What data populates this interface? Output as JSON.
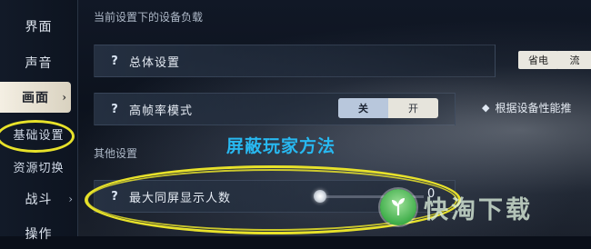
{
  "sidebar": {
    "items": [
      {
        "label": "界面",
        "arrow": ""
      },
      {
        "label": "声音",
        "arrow": ""
      },
      {
        "label": "画面",
        "arrow": "›"
      },
      {
        "label": "基础设置",
        "arrow": ""
      },
      {
        "label": "资源切换",
        "arrow": ""
      },
      {
        "label": "战斗",
        "arrow": "›"
      },
      {
        "label": "操作",
        "arrow": ""
      }
    ]
  },
  "main": {
    "section_current": "当前设置下的设备负载",
    "overall": {
      "label": "总体设置",
      "presets": [
        "省电",
        "流"
      ]
    },
    "high_fps": {
      "label": "高帧率模式",
      "toggle_off": "关",
      "toggle_on": "开"
    },
    "hint": "根据设备性能推",
    "section_other": "其他设置",
    "max_players": {
      "label": "最大同屏显示人数",
      "value": "0",
      "slider_fraction": 0
    }
  },
  "overlay": {
    "title": "屏蔽玩家方法"
  },
  "watermark": {
    "text": "快淘下载"
  },
  "colors": {
    "highlight_ring": "#e8e22a",
    "overlay_title": "#28b8f0",
    "active_tab_bg": "#f4efe3"
  }
}
